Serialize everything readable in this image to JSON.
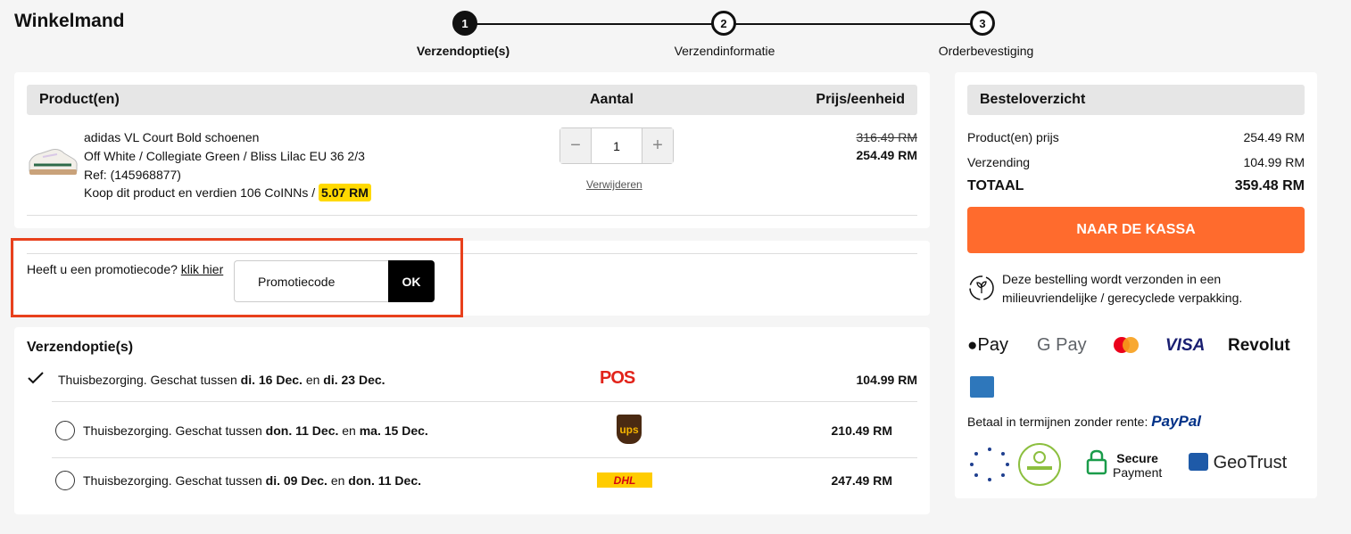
{
  "page": {
    "title": "Winkelmand"
  },
  "steps": [
    {
      "number": "1",
      "label": "Verzendoptie(s)"
    },
    {
      "number": "2",
      "label": "Verzendinformatie"
    },
    {
      "number": "3",
      "label": "Orderbevestiging"
    }
  ],
  "cart": {
    "headers": {
      "product": "Product(en)",
      "quantity": "Aantal",
      "unit_price": "Prijs/eenheid"
    },
    "item": {
      "name": "adidas VL Court Bold schoenen",
      "variant": "Off White / Collegiate Green / Bliss Lilac EU 36 2/3",
      "ref": "Ref: (145968877)",
      "coins_text": "Koop dit product en verdien 106 CoINNs / ",
      "coins_value": "5.07 RM",
      "quantity": "1",
      "remove_label": "Verwijderen",
      "price_old": "316.49 RM",
      "price_new": "254.49 RM"
    }
  },
  "promo": {
    "question": "Heeft u een promotiecode? ",
    "link": "klik hier",
    "placeholder": "Promotiecode",
    "ok": "OK"
  },
  "shipping": {
    "title": "Verzendoptie(s)",
    "options": [
      {
        "prefix": "Thuisbezorging. Geschat tussen ",
        "from": "di. 16 Dec.",
        "mid": " en ",
        "to": "di. 23 Dec.",
        "carrier": "POS",
        "price": "104.99 RM",
        "selected": true
      },
      {
        "prefix": "Thuisbezorging. Geschat tussen ",
        "from": "don. 11 Dec.",
        "mid": " en ",
        "to": "ma. 15 Dec.",
        "carrier": "ups",
        "price": "210.49 RM",
        "selected": false
      },
      {
        "prefix": "Thuisbezorging. Geschat tussen ",
        "from": "di. 09 Dec.",
        "mid": " en ",
        "to": "don. 11 Dec.",
        "carrier": "DHL",
        "price": "247.49 RM",
        "selected": false
      }
    ]
  },
  "summary": {
    "title": "Besteloverzicht",
    "product_label": "Product(en) prijs",
    "product_value": "254.49 RM",
    "shipping_label": "Verzending",
    "shipping_value": "104.99 RM",
    "total_label": "TOTAAL",
    "total_value": "359.48 RM",
    "checkout": "NAAR DE KASSA",
    "eco_text": "Deze bestelling wordt verzonden in een milieuvriendelijke / gerecyclede verpakking.",
    "payments": [
      "Pay",
      "G Pay",
      "VISA",
      "Revolut"
    ],
    "installments": "Betaal in termijnen zonder rente: ",
    "paypal": "PayPal",
    "trust": {
      "secure_1": "Secure",
      "secure_2": "Payment",
      "geotrust": "GeoTrust"
    }
  },
  "colors": {
    "accent": "#ff6b2d",
    "highlight": "#ffd900",
    "promo_outline": "#e8401c"
  }
}
